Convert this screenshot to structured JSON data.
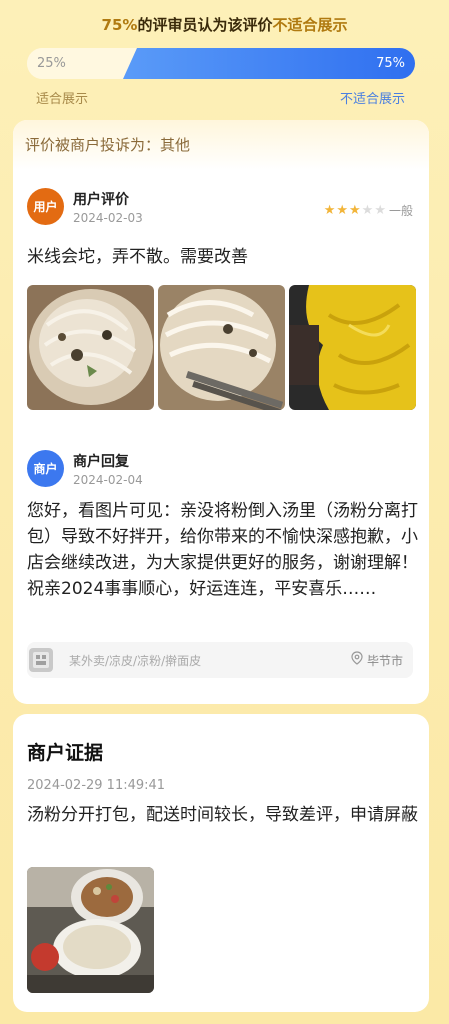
{
  "header": {
    "percent": "75%",
    "headline_mid": "的评审员认为该评价",
    "headline_end": "不适合展示",
    "bar_left_value": "25%",
    "bar_right_value": "75%",
    "label_left": "适合展示",
    "label_right": "不适合展示",
    "unsuitable_fraction": 0.75
  },
  "complaint": {
    "text": "评价被商户投诉为：其他"
  },
  "review": {
    "avatar_label": "用户",
    "name": "用户评价",
    "date": "2024-02-03",
    "stars": 3,
    "max_stars": 5,
    "rating_text": "一般",
    "text": "米线会坨，弄不散。需要改善"
  },
  "reply": {
    "avatar_label": "商户",
    "name": "商户回复",
    "date": "2024-02-04",
    "text": "您好，看图片可见：亲没将粉倒入汤里（汤粉分离打包）导致不好拌开，给你带来的不愉快深感抱歉，小店会继续改进，为大家提供更好的服务，谢谢理解！祝亲2024事事顺心，好运连连，平安喜乐……"
  },
  "shop": {
    "name": "某外卖/凉皮/凉粉/擀面皮",
    "location": "毕节市"
  },
  "evidence": {
    "title": "商户证据",
    "time": "2024-02-29 11:49:41",
    "text": "汤粉分开打包，配送时间较长，导致差评，申请屏蔽"
  },
  "colors": {
    "accent_orange": "#e36b12",
    "accent_blue": "#3c78ef",
    "star": "#f2b53a",
    "gold_text": "#b07a10"
  }
}
